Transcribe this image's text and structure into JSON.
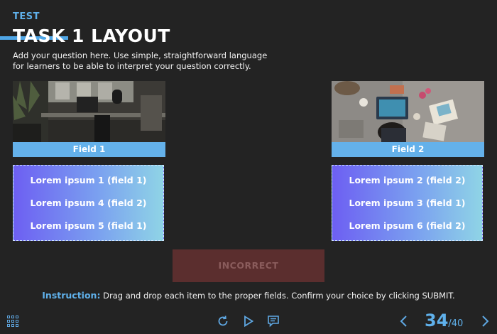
{
  "header": {
    "tag": "TEST",
    "title": "TASK 1 LAYOUT",
    "question": "Add your question here. Use simple, straightforward language for learners to be able to interpret your question correctly."
  },
  "fields": [
    {
      "label": "Field 1",
      "items": [
        "Lorem ipsum 1 (field 1)",
        "Lorem ipsum 4 (field 2)",
        "Lorem ipsum 5 (field 1)"
      ]
    },
    {
      "label": "Field 2",
      "items": [
        "Lorem ipsum 2 (field 2)",
        "Lorem ipsum 3 (field 1)",
        "Lorem ipsum 6 (field 2)"
      ]
    }
  ],
  "feedback": {
    "label": "INCORRECT",
    "color": "#5b2e2e"
  },
  "instruction": {
    "prefix": "Instruction:",
    "text": "Drag and drop each item to the proper fields. Confirm your choice by clicking SUBMIT."
  },
  "footer": {
    "icons": [
      "grid-menu-icon",
      "reload-icon",
      "play-icon",
      "chat-icon",
      "chevron-left-icon",
      "chevron-right-icon"
    ],
    "current_page": "34",
    "total_pages": "/40"
  },
  "colors": {
    "accent": "#5fb0ea",
    "background": "#232323",
    "field_label": "#64b1ea"
  }
}
